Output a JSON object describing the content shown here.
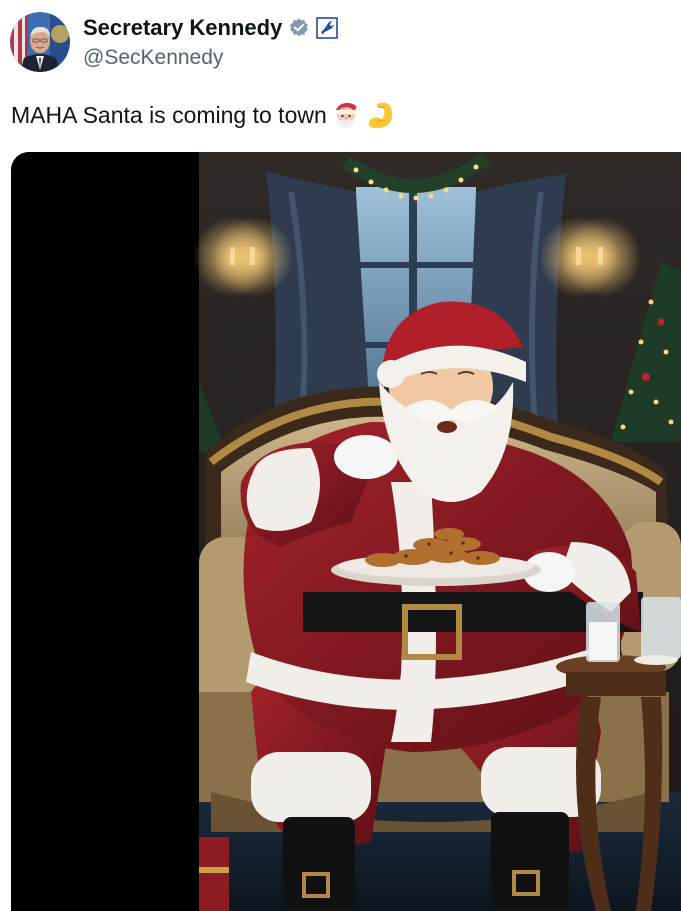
{
  "tweet": {
    "author": {
      "display_name": "Secretary Kennedy",
      "handle": "@SecKennedy",
      "verified_icon": "gray-verified-badge-icon",
      "affiliate_icon": "hhs-eagle-badge-icon"
    },
    "text": "MAHA Santa is coming to town",
    "emojis": [
      "santa-emoji",
      "flexed-biceps-emoji"
    ],
    "media": {
      "type": "video-still",
      "subject": "santa-eating-cookies"
    }
  },
  "colors": {
    "text_primary": "#0f1419",
    "text_secondary": "#536471",
    "verified_gray": "#829aab",
    "affiliate_blue": "#1d4f9c"
  }
}
